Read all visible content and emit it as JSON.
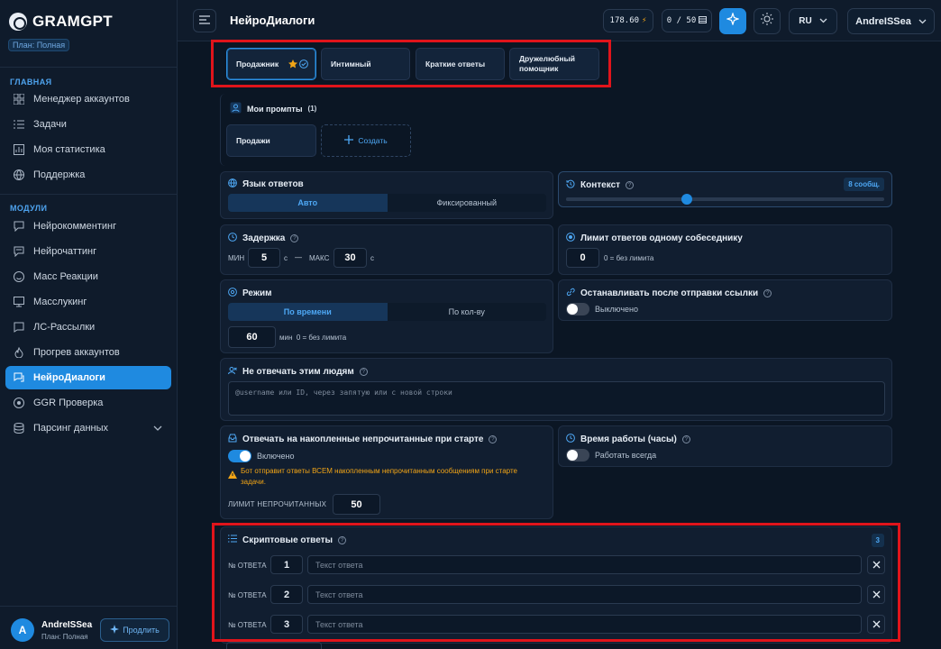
{
  "brand": {
    "name": "GRAMGPT",
    "plan_badge": "План: Полная"
  },
  "sidebar": {
    "main_section": "ГЛАВНАЯ",
    "main_items": [
      {
        "label": "Менеджер аккаунтов",
        "icon": "grid-icon"
      },
      {
        "label": "Задачи",
        "icon": "list-icon"
      },
      {
        "label": "Моя статистика",
        "icon": "chart-icon"
      },
      {
        "label": "Поддержка",
        "icon": "globe-icon"
      }
    ],
    "modules_section": "МОДУЛИ",
    "module_items": [
      {
        "label": "Нейрокомментинг",
        "icon": "comment-icon"
      },
      {
        "label": "Нейрочаттинг",
        "icon": "chat-icon"
      },
      {
        "label": "Масс Реакции",
        "icon": "smile-icon"
      },
      {
        "label": "Масслукинг",
        "icon": "monitor-icon"
      },
      {
        "label": "ЛС-Рассылки",
        "icon": "message-icon"
      },
      {
        "label": "Прогрев аккаунтов",
        "icon": "flame-icon"
      },
      {
        "label": "НейроДиалоги",
        "icon": "dialogs-icon",
        "active": true
      },
      {
        "label": "GGR Проверка",
        "icon": "check-circle-icon"
      },
      {
        "label": "Парсинг данных",
        "icon": "database-icon"
      }
    ],
    "user": {
      "avatar": "A",
      "name": "AndreISSea",
      "plan": "План: Полная"
    },
    "extend_label": "Продлить"
  },
  "header": {
    "title": "НейроДиалоги",
    "balance": "178.60",
    "balance_icon": "⚡",
    "counter": "0 / 50",
    "lang": "RU",
    "user_menu": "AndreISSea"
  },
  "presets": [
    "Продажник",
    "Интимный",
    "Краткие ответы",
    "Дружелюбный помощник"
  ],
  "my_prompts": {
    "title": "Мои промпты",
    "count": "(1)",
    "items": [
      "Продажи"
    ],
    "create_label": "Создать"
  },
  "language": {
    "title": "Язык ответов",
    "options": [
      "Авто",
      "Фиксированный"
    ],
    "selected": 0
  },
  "context": {
    "title": "Контекст",
    "badge": "8 сообщ.",
    "value_fraction": 0.38
  },
  "delay": {
    "title": "Задержка",
    "min_label": "МИН",
    "min": "5",
    "unit": "с",
    "dash": "—",
    "max_label": "МАКС",
    "max": "30"
  },
  "reply_limit": {
    "title": "Лимит ответов одному собеседнику",
    "value": "0",
    "hint": "0 = без лимита"
  },
  "mode": {
    "title": "Режим",
    "options": [
      "По времени",
      "По кол-ву"
    ],
    "selected": 0,
    "value": "60",
    "hint": "мин  0 = без лимита"
  },
  "stop_after_link": {
    "title": "Останавливать после отправки ссылки",
    "state": "Выключено"
  },
  "ignore_people": {
    "title": "Не отвечать этим людям",
    "placeholder": "@username или ID, через запятую или с новой строки"
  },
  "unread": {
    "title": "Отвечать на накопленные непрочитанные при старте",
    "state": "Включено",
    "warning": "Бот отправит ответы ВСЕМ накопленным непрочитанным сообщениям при старте задачи.",
    "limit_label": "ЛИМИТ НЕПРОЧИТАННЫХ",
    "limit": "50"
  },
  "work_hours": {
    "title": "Время работы (часы)",
    "state": "Работать всегда"
  },
  "scripted": {
    "title": "Скриптовые ответы",
    "count": "3",
    "rows": [
      {
        "label": "№ ОТВЕТА",
        "num": "1",
        "placeholder": "Текст ответа"
      },
      {
        "label": "№ ОТВЕТА",
        "num": "2",
        "placeholder": "Текст ответа"
      },
      {
        "label": "№ ОТВЕТА",
        "num": "3",
        "placeholder": "Текст ответа"
      }
    ]
  },
  "colors": {
    "accent": "#1f8ae0",
    "background": "#0b1624",
    "highlight": "#e0141b",
    "warning": "#f2a516"
  }
}
